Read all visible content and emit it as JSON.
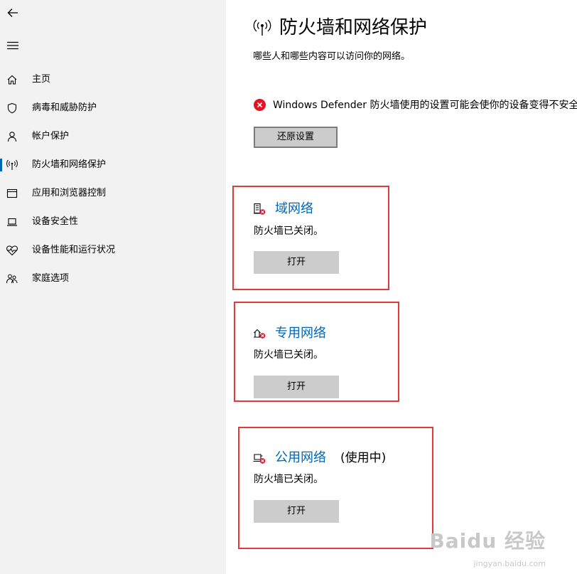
{
  "sidebar": {
    "items": [
      {
        "label": "主页",
        "icon": "home-icon"
      },
      {
        "label": "病毒和威胁防护",
        "icon": "shield-icon"
      },
      {
        "label": "帐户保护",
        "icon": "person-icon"
      },
      {
        "label": "防火墙和网络保护",
        "icon": "wireless-icon",
        "active": true
      },
      {
        "label": "应用和浏览器控制",
        "icon": "app-window-icon"
      },
      {
        "label": "设备安全性",
        "icon": "laptop-icon"
      },
      {
        "label": "设备性能和运行状况",
        "icon": "heart-pulse-icon"
      },
      {
        "label": "家庭选项",
        "icon": "family-icon"
      }
    ]
  },
  "header": {
    "title": "防火墙和网络保护",
    "subtitle": "哪些人和哪些内容可以访问你的网络。"
  },
  "warning": {
    "text": "Windows Defender 防火墙使用的设置可能会使你的设备变得不安全。",
    "button": "还原设置"
  },
  "networks": [
    {
      "title": "域网络",
      "status": "防火墙已关闭。",
      "button": "打开",
      "in_use": ""
    },
    {
      "title": "专用网络",
      "status": "防火墙已关闭。",
      "button": "打开",
      "in_use": ""
    },
    {
      "title": "公用网络",
      "status": "防火墙已关闭。",
      "button": "打开",
      "in_use": "(使用中)"
    }
  ],
  "watermark": {
    "brand": "Baidu 经验",
    "url": "jingyan.baidu.com"
  },
  "colors": {
    "accent": "#0067b8",
    "error": "#e81123",
    "highlight": "#e23a3a",
    "sidebar": "#f2f2f2"
  }
}
